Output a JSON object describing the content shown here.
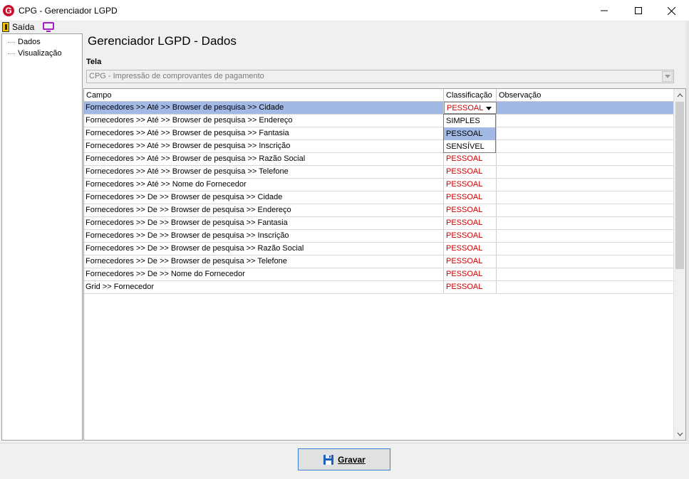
{
  "window": {
    "title": "CPG - Gerenciador LGPD",
    "app_icon_letter": "G"
  },
  "menu": {
    "exit_label": "Saída"
  },
  "tree": {
    "items": [
      {
        "label": "Dados"
      },
      {
        "label": "Visualização"
      }
    ]
  },
  "page": {
    "title": "Gerenciador LGPD - Dados"
  },
  "tela": {
    "label": "Tela",
    "value": "CPG - Impressão de comprovantes de pagamento"
  },
  "grid": {
    "columns": [
      "Campo",
      "Classificação",
      "Observação"
    ],
    "rows": [
      {
        "campo": "Fornecedores >> Até >> Browser de pesquisa >> Cidade",
        "classificacao": "PESSOAL",
        "observacao": ""
      },
      {
        "campo": "Fornecedores >> Até >> Browser de pesquisa >> Endereço",
        "classificacao": "",
        "observacao": ""
      },
      {
        "campo": "Fornecedores >> Até >> Browser de pesquisa >> Fantasia",
        "classificacao": "",
        "observacao": ""
      },
      {
        "campo": "Fornecedores >> Até >> Browser de pesquisa >> Inscrição",
        "classificacao": "",
        "observacao": ""
      },
      {
        "campo": "Fornecedores >> Até >> Browser de pesquisa >> Razão Social",
        "classificacao": "PESSOAL",
        "observacao": ""
      },
      {
        "campo": "Fornecedores >> Até >> Browser de pesquisa >> Telefone",
        "classificacao": "PESSOAL",
        "observacao": ""
      },
      {
        "campo": "Fornecedores >> Até >> Nome do Fornecedor",
        "classificacao": "PESSOAL",
        "observacao": ""
      },
      {
        "campo": "Fornecedores >> De >> Browser de pesquisa >> Cidade",
        "classificacao": "PESSOAL",
        "observacao": ""
      },
      {
        "campo": "Fornecedores >> De >> Browser de pesquisa >> Endereço",
        "classificacao": "PESSOAL",
        "observacao": ""
      },
      {
        "campo": "Fornecedores >> De >> Browser de pesquisa >> Fantasia",
        "classificacao": "PESSOAL",
        "observacao": ""
      },
      {
        "campo": "Fornecedores >> De >> Browser de pesquisa >> Inscrição",
        "classificacao": "PESSOAL",
        "observacao": ""
      },
      {
        "campo": "Fornecedores >> De >> Browser de pesquisa >> Razão Social",
        "classificacao": "PESSOAL",
        "observacao": ""
      },
      {
        "campo": "Fornecedores >> De >> Browser de pesquisa >> Telefone",
        "classificacao": "PESSOAL",
        "observacao": ""
      },
      {
        "campo": "Fornecedores >> De >> Nome do Fornecedor",
        "classificacao": "PESSOAL",
        "observacao": ""
      },
      {
        "campo": "Grid >> Fornecedor",
        "classificacao": "PESSOAL",
        "observacao": ""
      }
    ],
    "selected_row": 0,
    "dropdown_options": [
      "SIMPLES",
      "PESSOAL",
      "SENSÍVEL"
    ],
    "dropdown_highlighted": "PESSOAL"
  },
  "footer": {
    "save_label": "Gravar"
  },
  "colors": {
    "selection": "#a2b9e6",
    "classification_text": "#cc0000",
    "button_border": "#3c7fd1",
    "app_icon": "#c8102e"
  }
}
